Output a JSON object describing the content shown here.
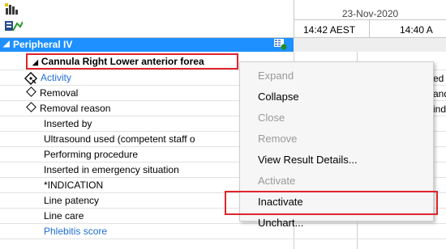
{
  "header": {
    "date": "23-Nov-2020",
    "times": [
      "14:42 AEST",
      "14:40 A"
    ]
  },
  "section": {
    "label": "Peripheral IV"
  },
  "rows": [
    {
      "label": "Cannula Right Lower anterior forea",
      "kind": "group"
    },
    {
      "label": "Activity",
      "kind": "link",
      "value": "ed"
    },
    {
      "label": "Removal",
      "kind": "diamond",
      "value": "anda"
    },
    {
      "label": "Removal reason",
      "kind": "diamond",
      "value": "indica"
    },
    {
      "label": "Inserted by",
      "kind": "plain"
    },
    {
      "label": "Ultrasound used (competent staff o",
      "kind": "plain"
    },
    {
      "label": "Performing procedure",
      "kind": "plain"
    },
    {
      "label": "Inserted in emergency situation",
      "kind": "plain"
    },
    {
      "label": "*INDICATION",
      "kind": "plain"
    },
    {
      "label": "Line patency",
      "kind": "plain"
    },
    {
      "label": "Line care",
      "kind": "plain"
    },
    {
      "label": "Phlebitis score",
      "kind": "link"
    }
  ],
  "context_menu": {
    "items": [
      {
        "label": "Expand",
        "enabled": false
      },
      {
        "label": "Collapse",
        "enabled": true
      },
      {
        "label": "Close",
        "enabled": false
      },
      {
        "label": "Remove",
        "enabled": false
      },
      {
        "label": "View Result Details...",
        "enabled": true
      },
      {
        "label": "Activate",
        "enabled": false
      },
      {
        "label": "Inactivate",
        "enabled": true
      },
      {
        "label": "Unchart...",
        "enabled": true
      }
    ]
  },
  "colors": {
    "section_bg": "#1e90ff",
    "highlight_border": "#e0242c",
    "link_text": "#1e6fd6"
  }
}
